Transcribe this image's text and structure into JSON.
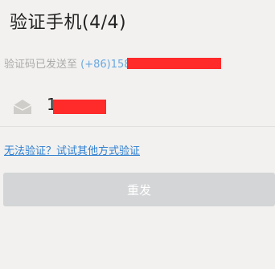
{
  "header": {
    "title": "验证手机(4/4)"
  },
  "verification": {
    "sent_to_label": "验证码已发送至",
    "phone_prefix": "(+86)",
    "phone_visible": "158 5801 3333",
    "redact_color": "#ff2a2a"
  },
  "code_input": {
    "icon": "envelope-open-icon",
    "value": "1"
  },
  "alt_link": {
    "label": "无法验证？试试其他方式验证"
  },
  "resend_button": {
    "label": "重发"
  },
  "colors": {
    "background": "#f2f1ef",
    "link": "#2f7fd0",
    "phone": "#6aa8e0",
    "button_disabled": "#d3d5d6"
  }
}
